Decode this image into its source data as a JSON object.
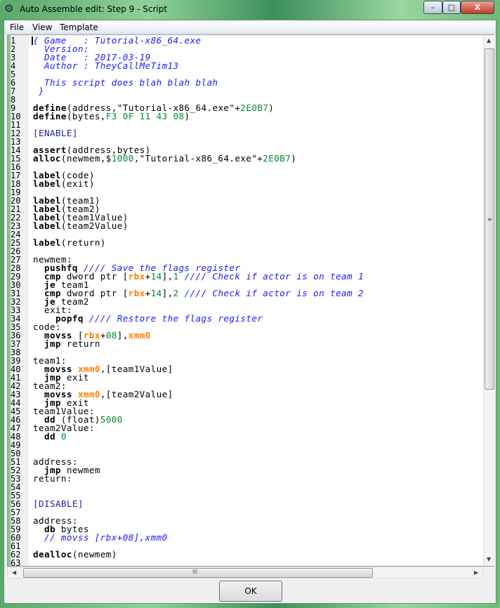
{
  "window": {
    "title": "Auto Assemble edit: Step 9 - Script",
    "minimize": "–",
    "maximize": "□",
    "close": "X"
  },
  "menu": [
    "File",
    "View",
    "Template"
  ],
  "ok_label": "OK",
  "scroll": {
    "h_grip": "III",
    "v_grip": "≡"
  },
  "code": {
    "lines": [
      [
        [
          "c",
          "{ Game   : Tutorial-x86_64.exe"
        ]
      ],
      [
        [
          "c",
          "  Version:"
        ]
      ],
      [
        [
          "c",
          "  Date   : 2017-03-19"
        ]
      ],
      [
        [
          "c",
          "  Author : TheyCallMeTim13"
        ]
      ],
      [],
      [
        [
          "c",
          "  This script does blah blah blah"
        ]
      ],
      [
        [
          "c",
          " }"
        ]
      ],
      [],
      [
        [
          "k",
          "define"
        ],
        [
          "n",
          "(address,\"Tutorial-x86_64.exe\"+"
        ],
        [
          "g",
          "2E0B7"
        ],
        [
          "n",
          ")"
        ]
      ],
      [
        [
          "k",
          "define"
        ],
        [
          "n",
          "(bytes,"
        ],
        [
          "g",
          "F3 0F 11 43 08"
        ],
        [
          "n",
          ")"
        ]
      ],
      [],
      [
        [
          "b",
          "[ENABLE]"
        ]
      ],
      [],
      [
        [
          "k",
          "assert"
        ],
        [
          "n",
          "(address,bytes)"
        ]
      ],
      [
        [
          "k",
          "alloc"
        ],
        [
          "n",
          "(newmem,$"
        ],
        [
          "g",
          "1000"
        ],
        [
          "n",
          ",\"Tutorial-x86_64.exe\"+"
        ],
        [
          "g",
          "2E0B7"
        ],
        [
          "n",
          ")"
        ]
      ],
      [],
      [
        [
          "k",
          "label"
        ],
        [
          "n",
          "(code)"
        ]
      ],
      [
        [
          "k",
          "label"
        ],
        [
          "n",
          "(exit)"
        ]
      ],
      [],
      [
        [
          "k",
          "label"
        ],
        [
          "n",
          "(team1)"
        ]
      ],
      [
        [
          "k",
          "label"
        ],
        [
          "n",
          "(team2)"
        ]
      ],
      [
        [
          "k",
          "label"
        ],
        [
          "n",
          "(team1Value)"
        ]
      ],
      [
        [
          "k",
          "label"
        ],
        [
          "n",
          "(team2Value)"
        ]
      ],
      [],
      [
        [
          "k",
          "label"
        ],
        [
          "n",
          "(return)"
        ]
      ],
      [],
      [
        [
          "n",
          "newmem:"
        ]
      ],
      [
        [
          "n",
          "  "
        ],
        [
          "k",
          "pushfq"
        ],
        [
          "n",
          " "
        ],
        [
          "c",
          "//// Save the flags register"
        ]
      ],
      [
        [
          "n",
          "  "
        ],
        [
          "k",
          "cmp"
        ],
        [
          "n",
          " dword ptr ["
        ],
        [
          "o",
          "rbx"
        ],
        [
          "n",
          "+"
        ],
        [
          "g",
          "14"
        ],
        [
          "n",
          "],"
        ],
        [
          "g",
          "1"
        ],
        [
          "n",
          " "
        ],
        [
          "c",
          "//// Check if actor is on team 1"
        ]
      ],
      [
        [
          "n",
          "  "
        ],
        [
          "k",
          "je"
        ],
        [
          "n",
          " team1"
        ]
      ],
      [
        [
          "n",
          "  "
        ],
        [
          "k",
          "cmp"
        ],
        [
          "n",
          " dword ptr ["
        ],
        [
          "o",
          "rbx"
        ],
        [
          "n",
          "+"
        ],
        [
          "g",
          "14"
        ],
        [
          "n",
          "],"
        ],
        [
          "g",
          "2"
        ],
        [
          "n",
          " "
        ],
        [
          "c",
          "//// Check if actor is on team 2"
        ]
      ],
      [
        [
          "n",
          "  "
        ],
        [
          "k",
          "je"
        ],
        [
          "n",
          " team2"
        ]
      ],
      [
        [
          "n",
          "  exit:"
        ]
      ],
      [
        [
          "n",
          "    "
        ],
        [
          "k",
          "popfq"
        ],
        [
          "n",
          " "
        ],
        [
          "c",
          "//// Restore the flags register"
        ]
      ],
      [
        [
          "n",
          "code:"
        ]
      ],
      [
        [
          "n",
          "  "
        ],
        [
          "k",
          "movss"
        ],
        [
          "n",
          " ["
        ],
        [
          "o",
          "rbx"
        ],
        [
          "n",
          "+"
        ],
        [
          "g",
          "08"
        ],
        [
          "n",
          "],"
        ],
        [
          "o",
          "xmm0"
        ]
      ],
      [
        [
          "n",
          "  "
        ],
        [
          "k",
          "jmp"
        ],
        [
          "n",
          " return"
        ]
      ],
      [],
      [
        [
          "n",
          "team1:"
        ]
      ],
      [
        [
          "n",
          "  "
        ],
        [
          "k",
          "movss"
        ],
        [
          "n",
          " "
        ],
        [
          "o",
          "xmm0"
        ],
        [
          "n",
          ",[team1Value]"
        ]
      ],
      [
        [
          "n",
          "  "
        ],
        [
          "k",
          "jmp"
        ],
        [
          "n",
          " exit"
        ]
      ],
      [
        [
          "n",
          "team2:"
        ]
      ],
      [
        [
          "n",
          "  "
        ],
        [
          "k",
          "movss"
        ],
        [
          "n",
          " "
        ],
        [
          "o",
          "xmm0"
        ],
        [
          "n",
          ",[team2Value]"
        ]
      ],
      [
        [
          "n",
          "  "
        ],
        [
          "k",
          "jmp"
        ],
        [
          "n",
          " exit"
        ]
      ],
      [
        [
          "n",
          "team1Value:"
        ]
      ],
      [
        [
          "n",
          "  "
        ],
        [
          "k",
          "dd"
        ],
        [
          "n",
          " (float)"
        ],
        [
          "g",
          "5000"
        ]
      ],
      [
        [
          "n",
          "team2Value:"
        ]
      ],
      [
        [
          "n",
          "  "
        ],
        [
          "k",
          "dd"
        ],
        [
          "n",
          " "
        ],
        [
          "g",
          "0"
        ]
      ],
      [],
      [],
      [
        [
          "n",
          "address:"
        ]
      ],
      [
        [
          "n",
          "  "
        ],
        [
          "k",
          "jmp"
        ],
        [
          "n",
          " newmem"
        ]
      ],
      [
        [
          "n",
          "return:"
        ]
      ],
      [],
      [],
      [
        [
          "b",
          "[DISABLE]"
        ]
      ],
      [],
      [
        [
          "n",
          "address:"
        ]
      ],
      [
        [
          "n",
          "  "
        ],
        [
          "k",
          "db"
        ],
        [
          "n",
          " bytes"
        ]
      ],
      [
        [
          "n",
          "  "
        ],
        [
          "c",
          "// movss [rbx+08],xmm0"
        ]
      ],
      [],
      [
        [
          "k",
          "dealloc"
        ],
        [
          "n",
          "(newmem)"
        ]
      ],
      []
    ]
  }
}
